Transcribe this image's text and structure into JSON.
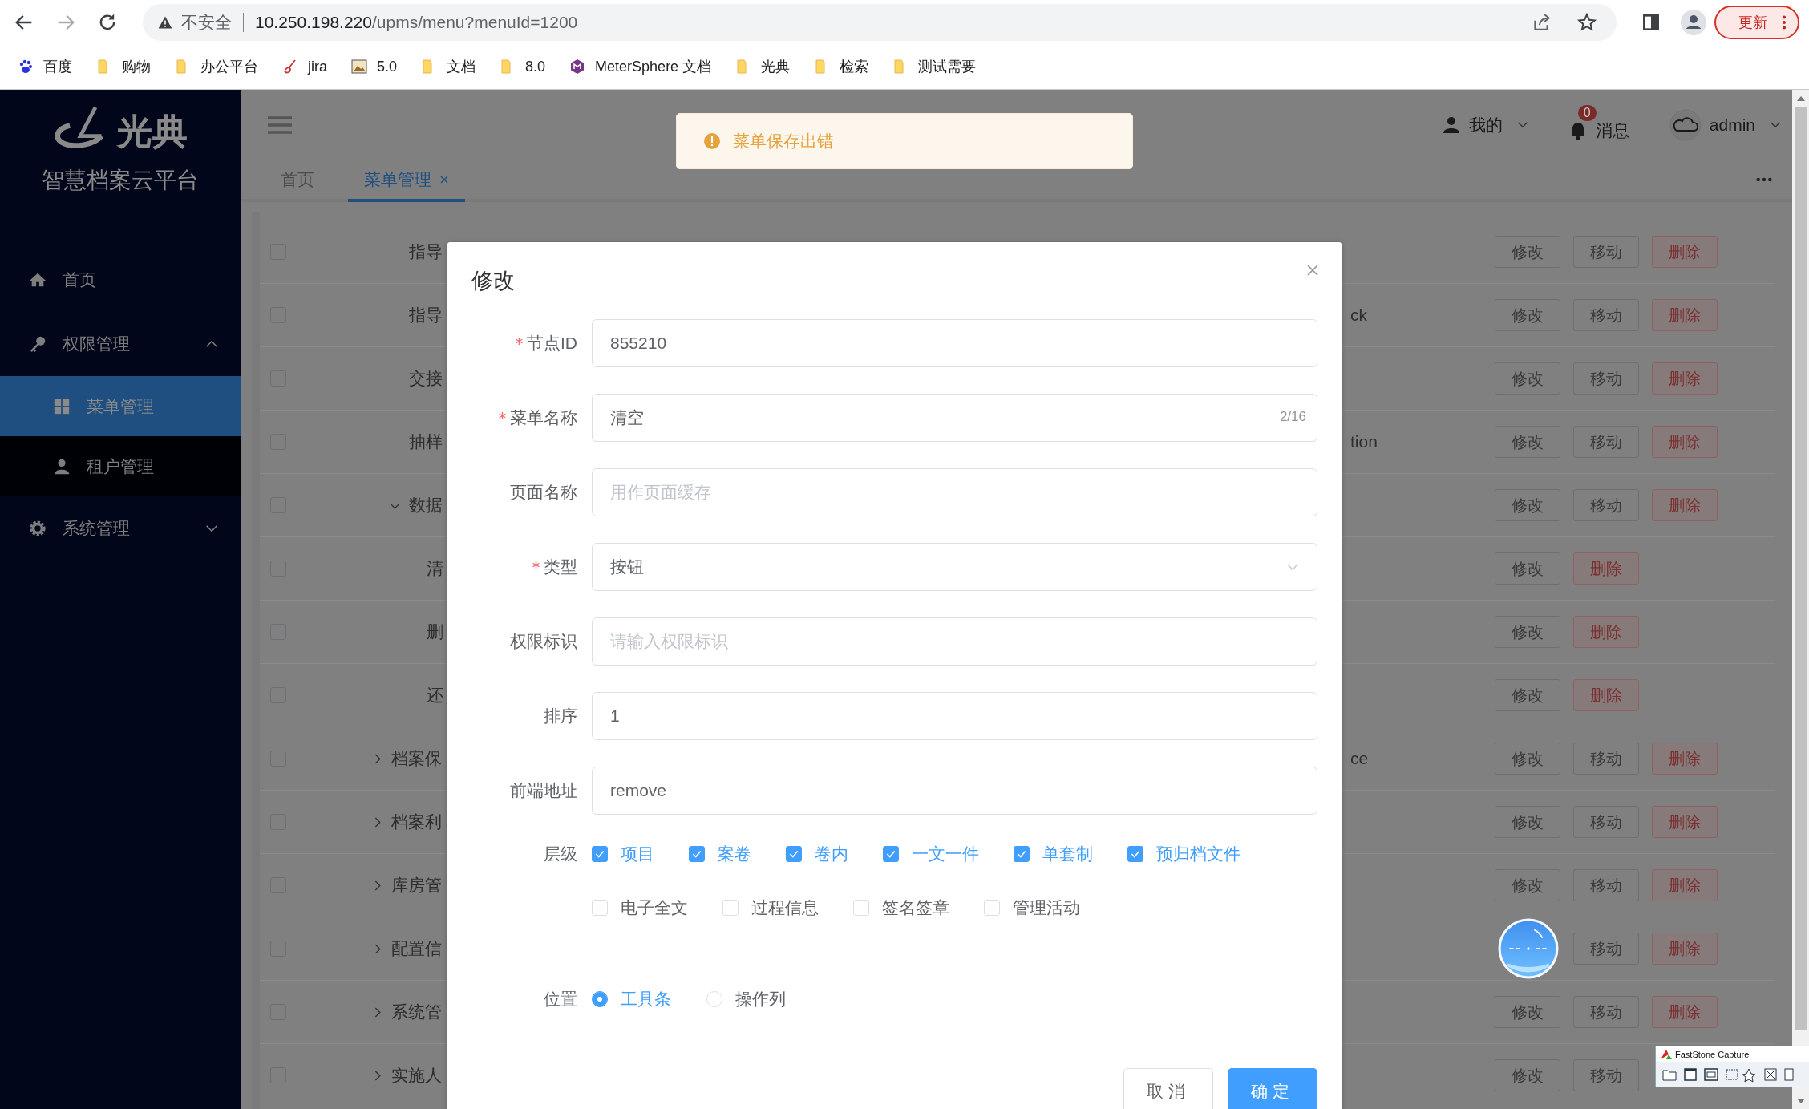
{
  "browser": {
    "security": "不安全",
    "host": "10.250.198.220",
    "path": "/upms/menu?menuId=1200",
    "update_button": "更新",
    "bookmarks": [
      {
        "label": "百度",
        "kind": "paw"
      },
      {
        "label": "购物",
        "kind": "folder"
      },
      {
        "label": "办公平台",
        "kind": "folder"
      },
      {
        "label": "jira",
        "kind": "brush"
      },
      {
        "label": "5.0",
        "kind": "image"
      },
      {
        "label": "文档",
        "kind": "folder"
      },
      {
        "label": "8.0",
        "kind": "folder"
      },
      {
        "label": "MeterSphere 文档",
        "kind": "hexagon"
      },
      {
        "label": "光典",
        "kind": "folder"
      },
      {
        "label": "检索",
        "kind": "folder"
      },
      {
        "label": "测试需要",
        "kind": "folder"
      }
    ]
  },
  "sidebar": {
    "logo_text": "光典",
    "platform_name": "智慧档案云平台",
    "items": [
      {
        "label": "首页",
        "selected": false
      },
      {
        "label": "权限管理",
        "selected": false,
        "expanded": true,
        "children": [
          {
            "label": "菜单管理",
            "selected": true
          },
          {
            "label": "租户管理",
            "selected": false
          }
        ]
      },
      {
        "label": "系统管理",
        "selected": false,
        "expanded": false
      }
    ]
  },
  "header": {
    "my_label": "我的",
    "message_label": "消息",
    "message_count": "0",
    "user": "admin"
  },
  "tabs": [
    {
      "label": "首页",
      "selected": false,
      "closable": false
    },
    {
      "label": "菜单管理",
      "selected": true,
      "closable": true
    }
  ],
  "toast": {
    "kind": "warning",
    "message": "菜单保存出错"
  },
  "table": {
    "rows": [
      {
        "children": [
          {
            "name": "指导",
            "checked": false,
            "actions": [
              {
                "kind": "edit",
                "label": "修改"
              },
              {
                "kind": "move",
                "label": "移动"
              },
              {
                "kind": "delete",
                "label": "删除"
              }
            ]
          },
          {
            "name": "指导",
            "column_2": "ck",
            "checked": false,
            "actions": [
              {
                "kind": "edit",
                "label": "修改"
              },
              {
                "kind": "move",
                "label": "移动"
              },
              {
                "kind": "delete",
                "label": "删除"
              }
            ]
          },
          {
            "name": "交接",
            "checked": false,
            "actions": [
              {
                "kind": "edit",
                "label": "修改"
              },
              {
                "kind": "move",
                "label": "移动"
              },
              {
                "kind": "delete",
                "label": "删除"
              }
            ]
          },
          {
            "name": "抽样",
            "column_2": "tion",
            "checked": false,
            "actions": [
              {
                "kind": "edit",
                "label": "修改"
              },
              {
                "kind": "move",
                "label": "移动"
              },
              {
                "kind": "delete",
                "label": "删除"
              }
            ]
          },
          {
            "name": "数据",
            "checked": false,
            "expanded": true,
            "actions": [
              {
                "kind": "edit",
                "label": "修改"
              },
              {
                "kind": "move",
                "label": "移动"
              },
              {
                "kind": "delete",
                "label": "删除"
              }
            ],
            "children": [
              {
                "name": "清",
                "checked": false,
                "actions": [
                  {
                    "kind": "edit",
                    "label": "修改"
                  },
                  {
                    "kind": "delete",
                    "label": "删除"
                  }
                ]
              },
              {
                "name": "删",
                "checked": false,
                "actions": [
                  {
                    "kind": "edit",
                    "label": "修改"
                  },
                  {
                    "kind": "delete",
                    "label": "删除"
                  }
                ]
              },
              {
                "name": "还",
                "checked": false,
                "actions": [
                  {
                    "kind": "edit",
                    "label": "修改"
                  },
                  {
                    "kind": "delete",
                    "label": "删除"
                  }
                ]
              }
            ]
          }
        ]
      },
      {
        "name": "档案保",
        "column_2": "ce",
        "checked": false,
        "expanded": false,
        "actions": [
          {
            "kind": "edit",
            "label": "修改"
          },
          {
            "kind": "move",
            "label": "移动"
          },
          {
            "kind": "delete",
            "label": "删除"
          }
        ]
      },
      {
        "name": "档案利",
        "checked": false,
        "expanded": false,
        "actions": [
          {
            "kind": "edit",
            "label": "修改"
          },
          {
            "kind": "move",
            "label": "移动"
          },
          {
            "kind": "delete",
            "label": "删除"
          }
        ]
      },
      {
        "name": "库房管",
        "checked": false,
        "expanded": false,
        "actions": [
          {
            "kind": "edit",
            "label": "修改"
          },
          {
            "kind": "move",
            "label": "移动"
          },
          {
            "kind": "delete",
            "label": "删除"
          }
        ]
      },
      {
        "name": "配置信",
        "checked": false,
        "expanded": false,
        "actions": [
          {
            "kind": "covered"
          },
          {
            "kind": "move",
            "label": "移动"
          },
          {
            "kind": "delete",
            "label": "删除"
          }
        ]
      },
      {
        "name": "系统管",
        "checked": false,
        "expanded": false,
        "actions": [
          {
            "kind": "edit",
            "label": "修改"
          },
          {
            "kind": "move",
            "label": "移动"
          },
          {
            "kind": "delete",
            "label": "删除"
          }
        ]
      },
      {
        "name": "实施人",
        "checked": false,
        "expanded": false,
        "actions": [
          {
            "kind": "edit",
            "label": "修改"
          },
          {
            "kind": "move",
            "label": "移动"
          }
        ]
      }
    ]
  },
  "dialog": {
    "title": "修改",
    "fields": [
      {
        "label": "节点ID",
        "required": true,
        "kind": "text",
        "value": "855210"
      },
      {
        "label": "菜单名称",
        "required": true,
        "kind": "text",
        "value": "清空",
        "counter": "2/16"
      },
      {
        "label": "页面名称",
        "required": false,
        "kind": "text",
        "placeholder": "用作页面缓存"
      },
      {
        "label": "类型",
        "required": true,
        "kind": "select",
        "value": "按钮"
      },
      {
        "label": "权限标识",
        "required": false,
        "kind": "text",
        "placeholder": "请输入权限标识"
      },
      {
        "label": "排序",
        "required": false,
        "kind": "text",
        "value": "1"
      },
      {
        "label": "前端地址",
        "required": false,
        "kind": "text",
        "value": "remove"
      }
    ],
    "level_label": "层级",
    "levels": [
      {
        "label": "项目",
        "checked": true
      },
      {
        "label": "案卷",
        "checked": true
      },
      {
        "label": "卷内",
        "checked": true
      },
      {
        "label": "一文一件",
        "checked": true
      },
      {
        "label": "单套制",
        "checked": true
      },
      {
        "label": "预归档文件",
        "checked": true
      },
      {
        "label": "电子全文",
        "checked": false
      },
      {
        "label": "过程信息",
        "checked": false
      },
      {
        "label": "签名签章",
        "checked": false
      },
      {
        "label": "管理活动",
        "checked": false
      }
    ],
    "position_label": "位置",
    "positions": [
      {
        "label": "工具条",
        "selected": true
      },
      {
        "label": "操作列",
        "selected": false
      }
    ],
    "buttons": [
      {
        "label": "取消",
        "kind": "secondary"
      },
      {
        "label": "确定",
        "kind": "primary"
      }
    ]
  },
  "capture_tool": {
    "title": "FastStone Capture"
  }
}
